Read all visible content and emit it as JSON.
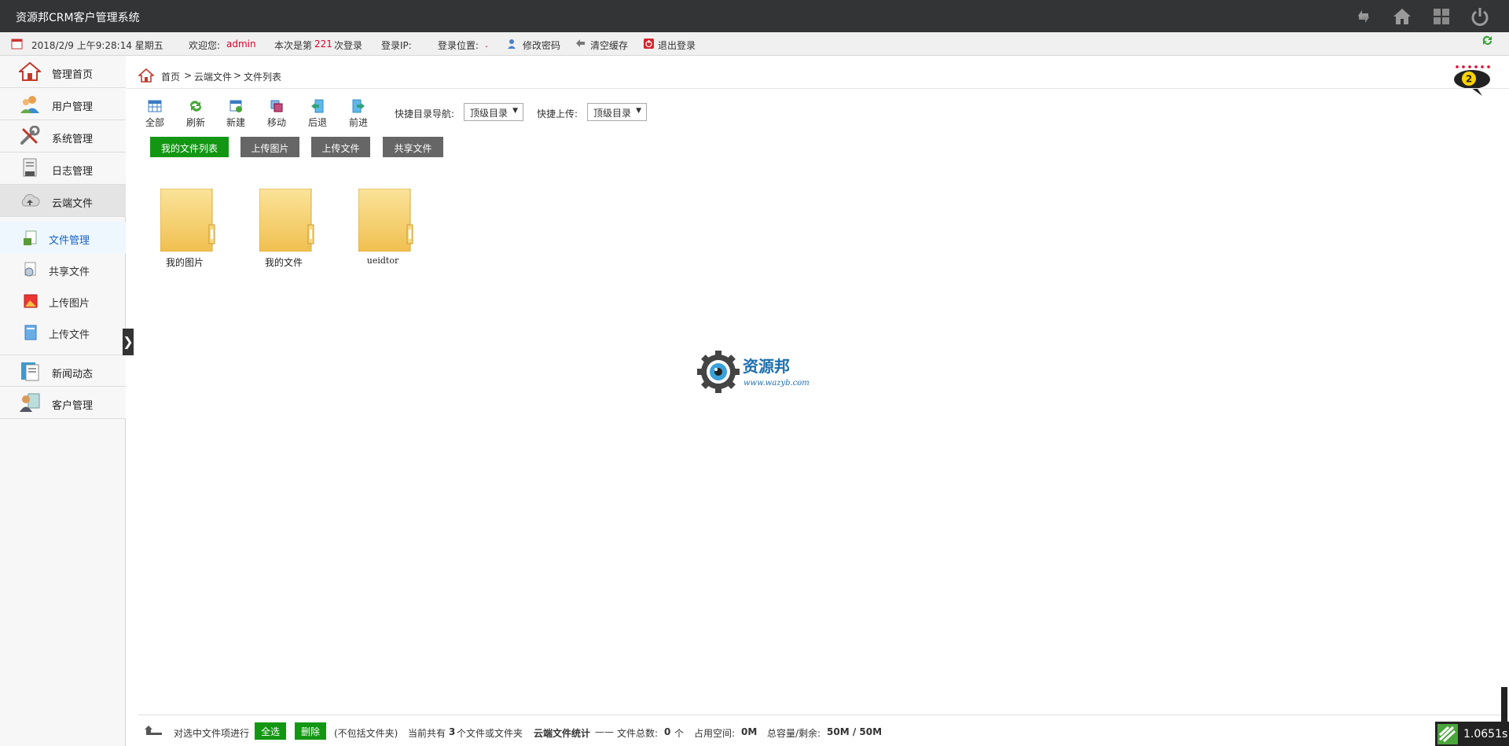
{
  "app": {
    "title": "资源邦CRM客户管理系统"
  },
  "top_icons": [
    "refresh-icon",
    "home-icon",
    "grid-icon",
    "power-icon"
  ],
  "infobar": {
    "datetime": "2018/2/9 上午9:28:14 星期五",
    "welcome_prefix": "欢迎您:",
    "username": "admin",
    "login_count_prefix": "本次是第",
    "login_count": "221",
    "login_count_suffix": "次登录",
    "login_ip_label": "登录IP:",
    "login_location_label": "登录位置:",
    "login_location_value": ".",
    "change_password": "修改密码",
    "clear_cache": "清空缓存",
    "logout": "退出登录"
  },
  "sidebar": {
    "items": [
      {
        "label": "管理首页",
        "icon": "house-icon"
      },
      {
        "label": "用户管理",
        "icon": "users-icon"
      },
      {
        "label": "系统管理",
        "icon": "tools-icon"
      },
      {
        "label": "日志管理",
        "icon": "log-icon"
      },
      {
        "label": "云端文件",
        "icon": "cloud-icon"
      }
    ],
    "sub_items": [
      {
        "label": "文件管理",
        "icon": "file-manage-icon"
      },
      {
        "label": "共享文件",
        "icon": "share-file-icon"
      },
      {
        "label": "上传图片",
        "icon": "upload-image-icon"
      },
      {
        "label": "上传文件",
        "icon": "upload-file-icon"
      }
    ],
    "bottom_items": [
      {
        "label": "新闻动态",
        "icon": "news-icon"
      },
      {
        "label": "客户管理",
        "icon": "customer-icon"
      }
    ],
    "collapse_glyph": "❯"
  },
  "breadcrumb": {
    "home": "首页",
    "sep": ">",
    "level1": "云端文件",
    "level2": "文件列表"
  },
  "notification": {
    "count": "2"
  },
  "toolbar": {
    "buttons": [
      {
        "label": "全部",
        "icon": "table-icon"
      },
      {
        "label": "刷新",
        "icon": "refresh-icon"
      },
      {
        "label": "新建",
        "icon": "new-icon"
      },
      {
        "label": "移动",
        "icon": "move-icon"
      },
      {
        "label": "后退",
        "icon": "back-icon"
      },
      {
        "label": "前进",
        "icon": "forward-icon"
      }
    ],
    "quick_nav_label": "快捷目录导航:",
    "quick_nav_value": "顶级目录",
    "quick_upload_label": "快捷上传:",
    "quick_upload_value": "顶级目录"
  },
  "tabs": [
    {
      "label": "我的文件列表",
      "active": true
    },
    {
      "label": "上传图片",
      "active": false
    },
    {
      "label": "上传文件",
      "active": false
    },
    {
      "label": "共享文件",
      "active": false
    }
  ],
  "folders": [
    {
      "name": "我的图片"
    },
    {
      "name": "我的文件"
    },
    {
      "name": "ueidtor"
    }
  ],
  "watermark": {
    "brand": "资源邦",
    "url": "www.wazyb.com"
  },
  "footer": {
    "selected_action": "对选中文件项进行",
    "select_all": "全选",
    "delete": "删除",
    "exclude_folders": "(不包括文件夹)",
    "current_total_prefix": "当前共有",
    "current_total": "3",
    "current_total_suffix": "个文件或文件夹",
    "stats_label": "云端文件统计",
    "stats_dash": "——",
    "file_total_label": "文件总数:",
    "file_total": "0",
    "file_total_unit": "个",
    "used_label": "占用空间:",
    "used_value": "0M",
    "capacity_label": "总容量/剩余:",
    "capacity_value": "50M / 50M"
  },
  "timer": {
    "value": "1.0651s"
  },
  "colors": {
    "topbar": "#333435",
    "active_green": "#139713",
    "alert_red": "#e0002a",
    "link_blue": "#1a62c4"
  }
}
